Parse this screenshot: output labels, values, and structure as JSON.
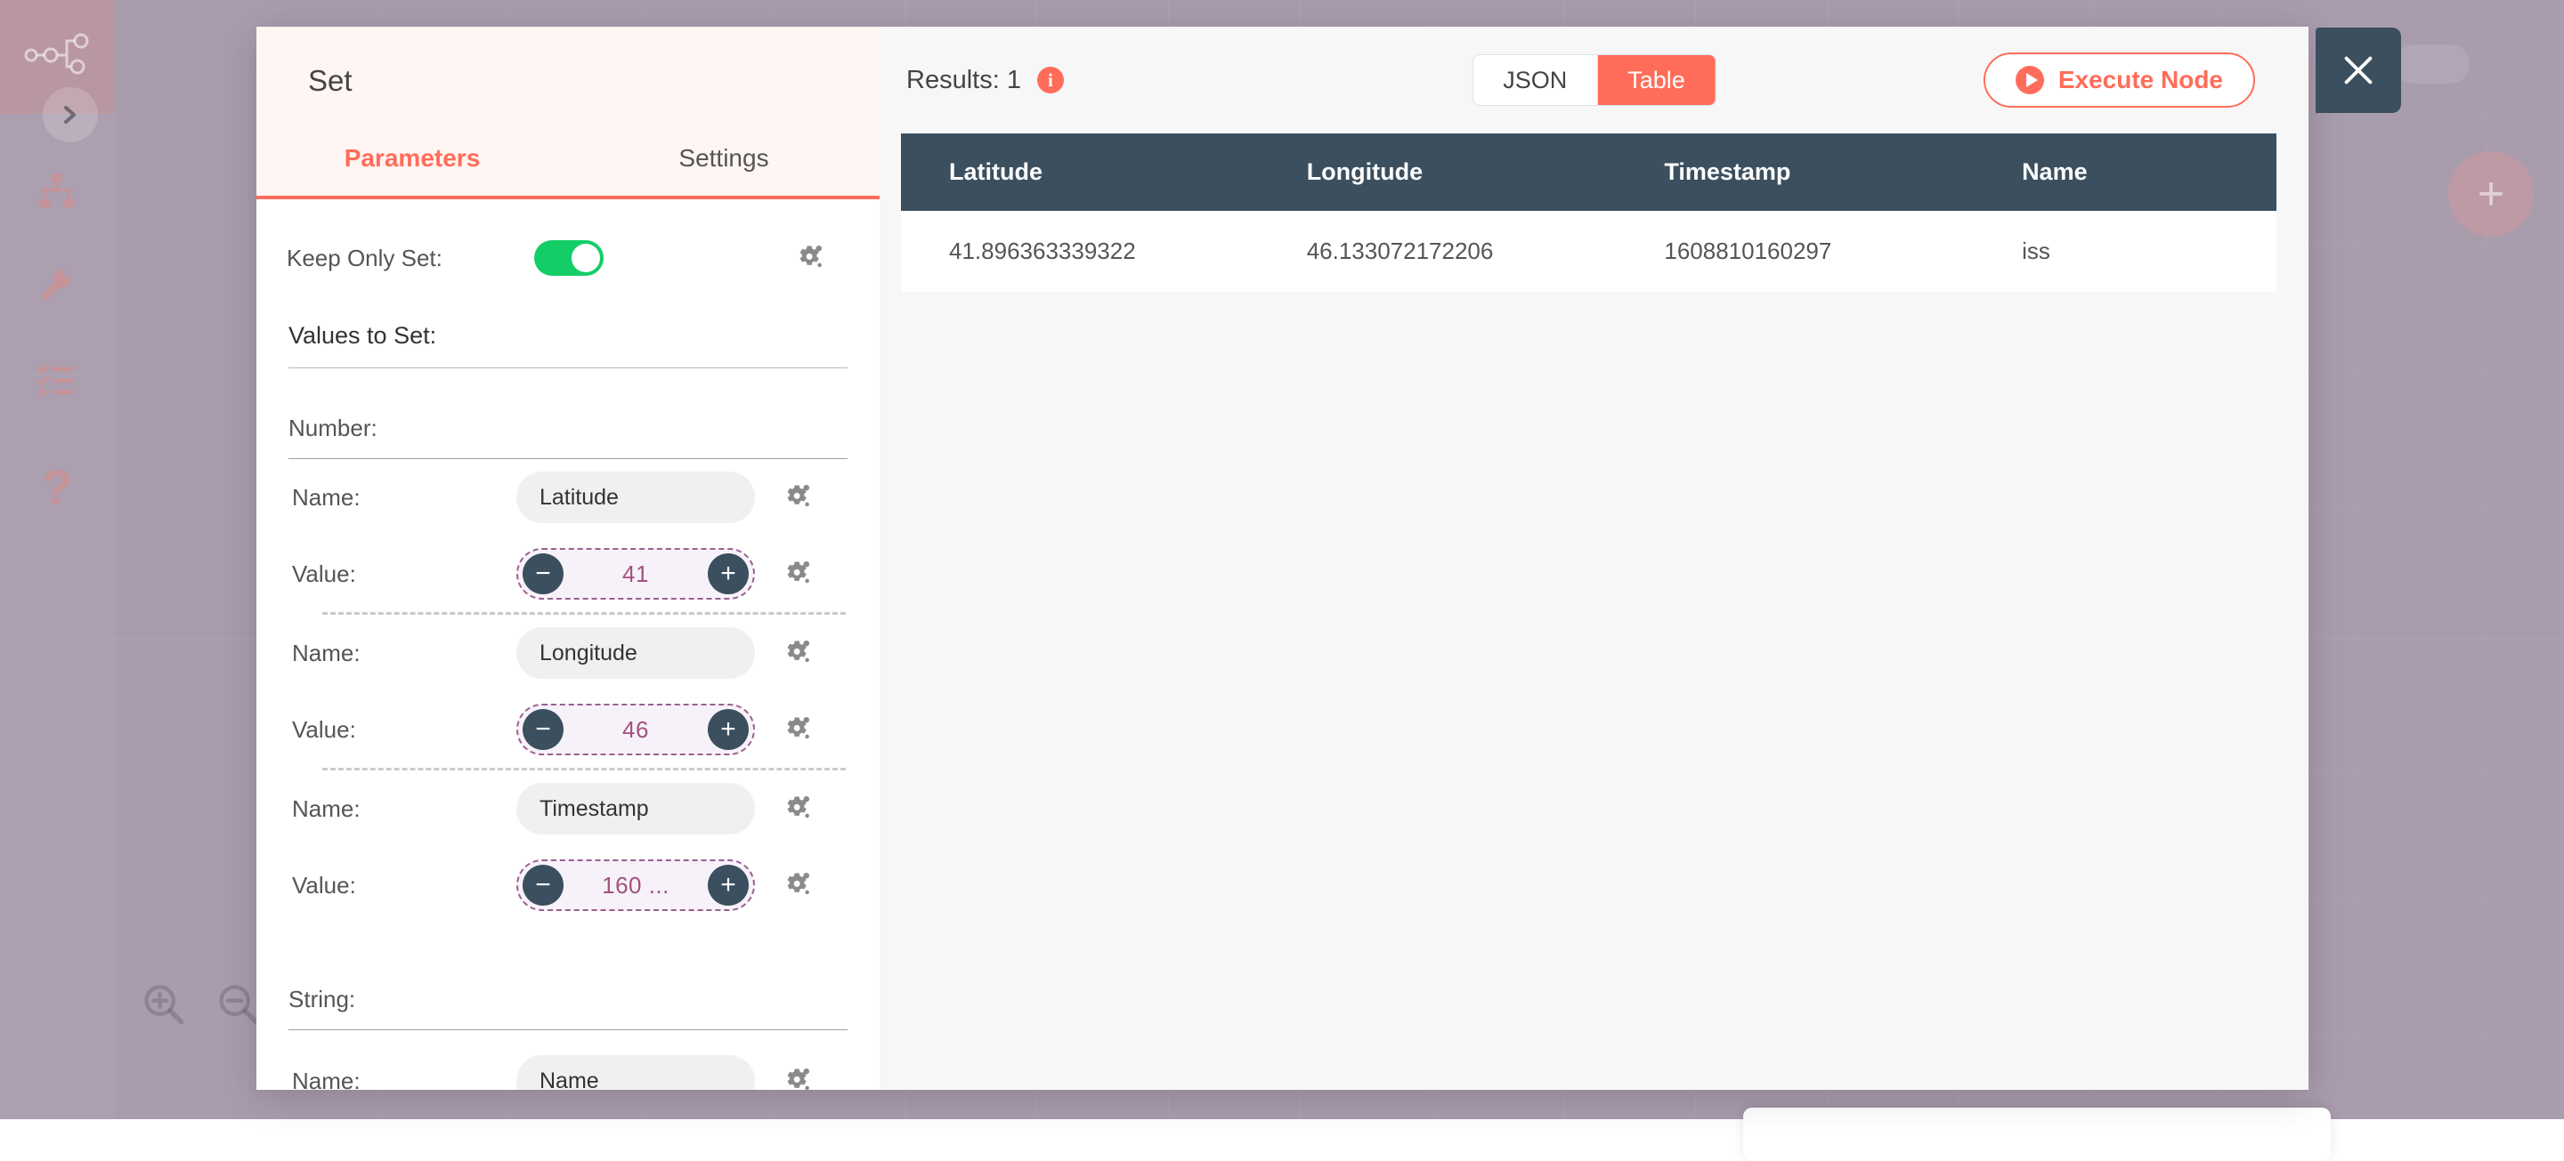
{
  "sidebar": {
    "items": [
      {
        "name": "workflow-logo-icon",
        "label": "n8n"
      },
      {
        "name": "expand-sidebar-icon",
        "label": "›"
      },
      {
        "name": "workflows-icon",
        "label": "Workflows"
      },
      {
        "name": "credentials-key-icon",
        "label": "Credentials"
      },
      {
        "name": "executions-list-icon",
        "label": "Executions"
      },
      {
        "name": "help-question-icon",
        "label": "Help"
      }
    ]
  },
  "canvas": {
    "zoom_in_label": "Zoom in",
    "zoom_out_label": "Zoom out",
    "add_node_label": "+"
  },
  "ndv": {
    "node_title": "Set",
    "tabs": [
      {
        "label": "Parameters",
        "active": true
      },
      {
        "label": "Settings",
        "active": false
      }
    ],
    "keep_only_set": {
      "label": "Keep Only Set:",
      "value": "on"
    },
    "values_to_set_label": "Values to Set:",
    "sections": [
      {
        "type_label": "Number:",
        "entries": [
          {
            "name_label": "Name:",
            "name_value": "Latitude",
            "value_label": "Value:",
            "value_value": "41",
            "minus": "−",
            "plus": "+"
          },
          {
            "name_label": "Name:",
            "name_value": "Longitude",
            "value_label": "Value:",
            "value_value": "46",
            "minus": "−",
            "plus": "+"
          },
          {
            "name_label": "Name:",
            "name_value": "Timestamp",
            "value_label": "Value:",
            "value_value": "160  ...",
            "minus": "−",
            "plus": "+"
          }
        ]
      },
      {
        "type_label": "String:",
        "entries": [
          {
            "name_label": "Name:",
            "name_value": "Name",
            "value_label": "",
            "value_value": "",
            "minus": "",
            "plus": ""
          }
        ]
      }
    ],
    "gear_icon_name": "settings-gear-icon"
  },
  "output": {
    "results_label": "Results: 1",
    "results_info_icon": "i",
    "view_switch": [
      {
        "label": "JSON",
        "active": false
      },
      {
        "label": "Table",
        "active": true
      }
    ],
    "execute_button_label": "Execute Node",
    "play_icon": "play-icon",
    "table": {
      "columns": [
        "Latitude",
        "Longitude",
        "Timestamp",
        "Name"
      ],
      "rows": [
        [
          "41.896363339322",
          "46.133072172206",
          "1608810160297",
          "iss"
        ]
      ]
    }
  },
  "close_button": {
    "label": "×",
    "icon": "close-icon"
  },
  "colors": {
    "accent": "#ff6d5a",
    "header_bg": "#fff5f2",
    "table_header_bg": "#3b4f5e",
    "toggle_on": "#13ce66",
    "expression_border": "#9b5f8e",
    "canvas_bg": "#a99cad"
  }
}
